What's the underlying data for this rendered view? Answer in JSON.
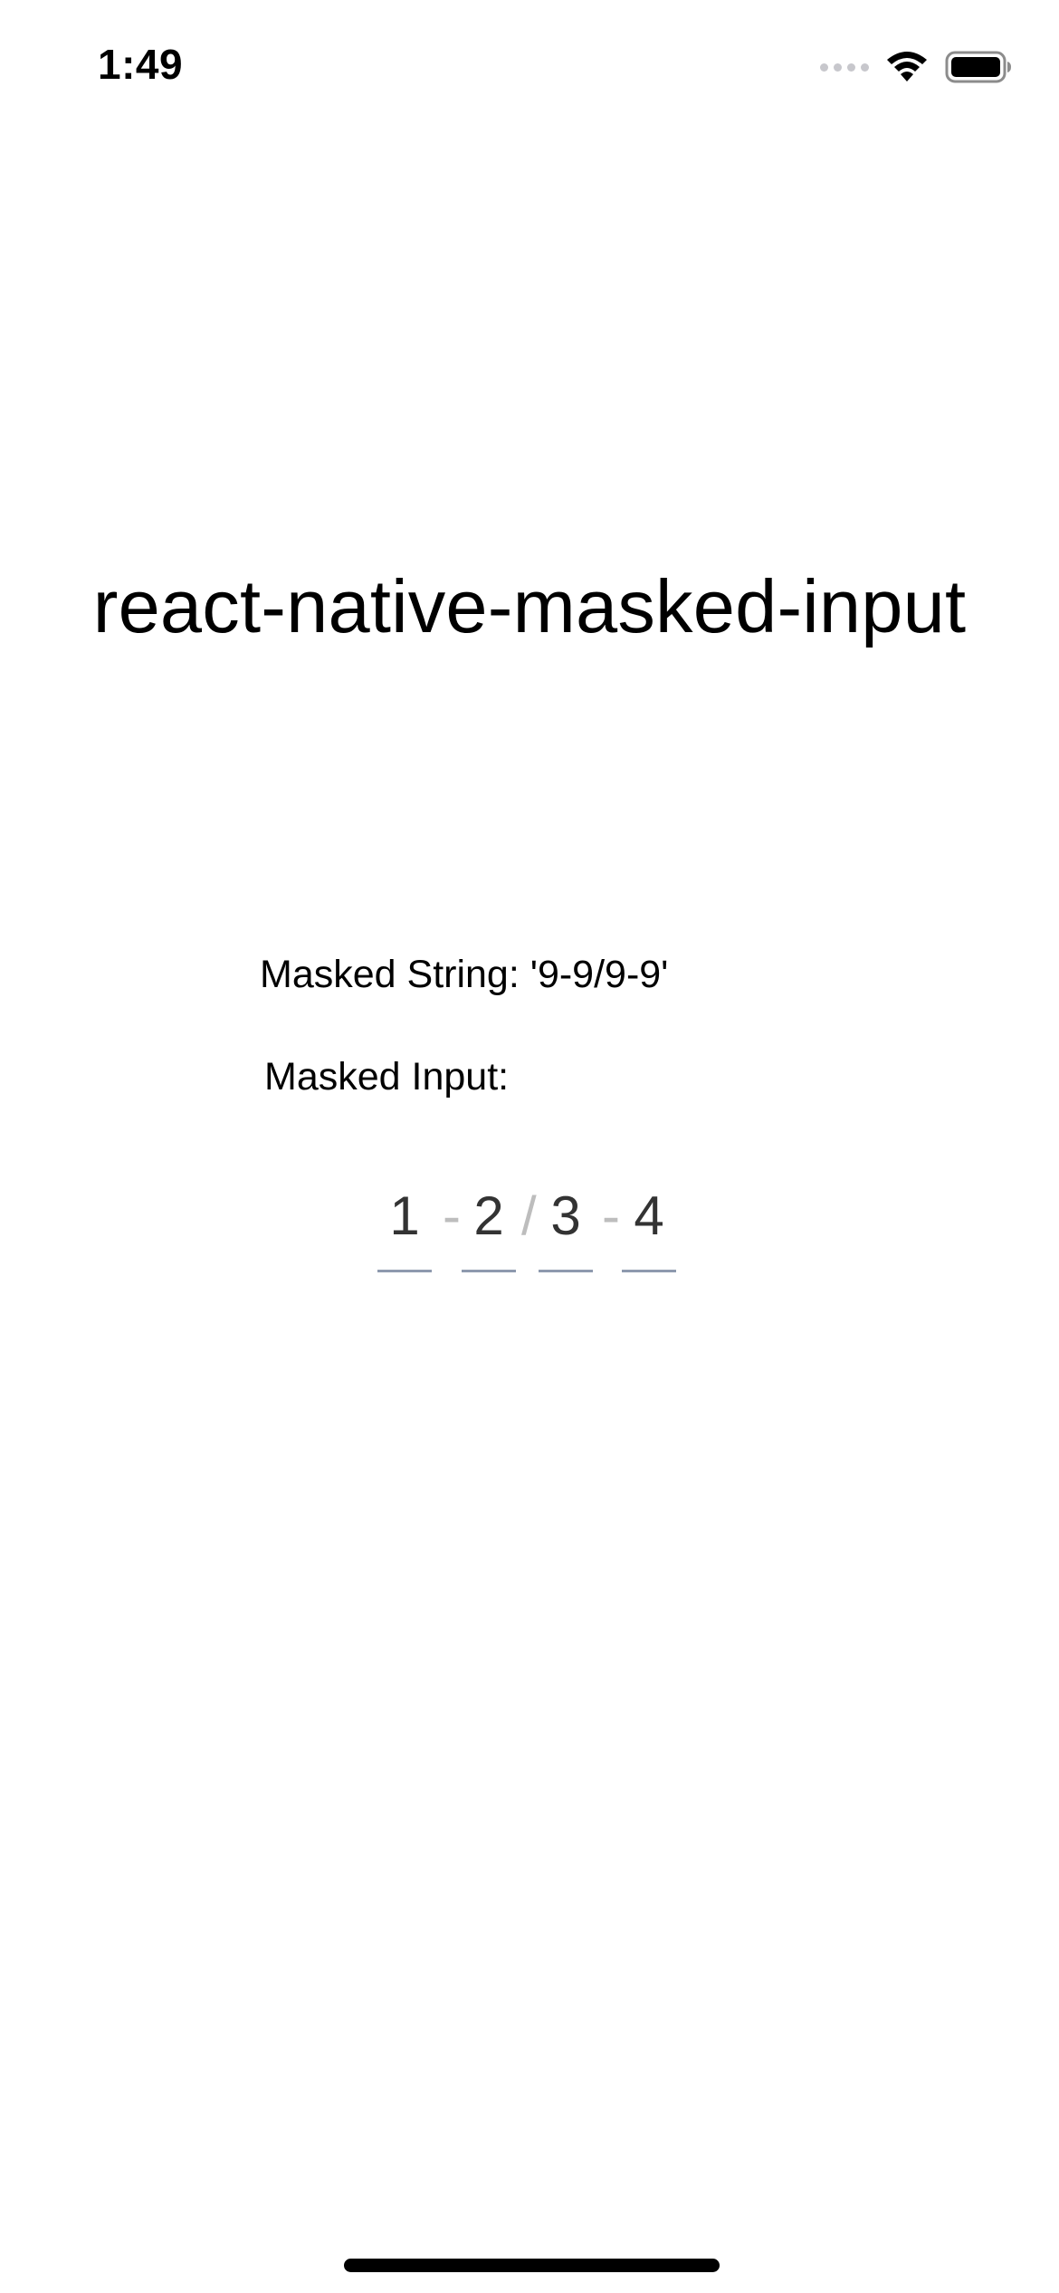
{
  "status_bar": {
    "time": "1:49",
    "icons": [
      "cellular-signal-icon",
      "wifi-icon",
      "battery-icon"
    ]
  },
  "app": {
    "title": "react-native-masked-input",
    "masked_string_label": "Masked String: '9-9/9-9'",
    "masked_input_label": "Masked Input:"
  },
  "masked_input": {
    "digits": [
      "1",
      "2",
      "3",
      "4"
    ],
    "separators": [
      "-",
      "/",
      "-"
    ]
  },
  "colors": {
    "underline": "#8e9aae",
    "separator": "#bdbdbd",
    "digit_text": "#333333"
  }
}
